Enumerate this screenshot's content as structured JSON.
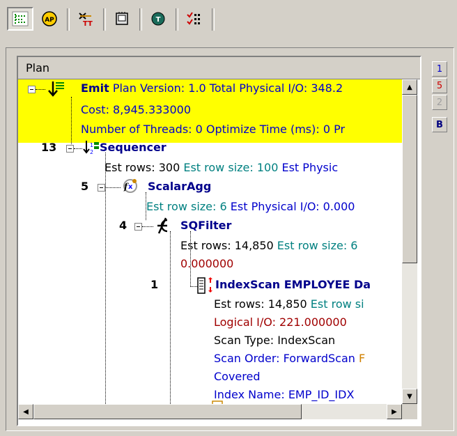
{
  "toolbar": {
    "buttons": [
      {
        "icon": "plan-tree-icon",
        "pressed": true
      },
      {
        "icon": "ap-icon"
      },
      {
        "icon": "text-plan-icon"
      },
      {
        "icon": "memory-icon"
      },
      {
        "icon": "timing-icon"
      },
      {
        "icon": "checklist-icon"
      }
    ]
  },
  "tree": {
    "header": "Plan",
    "emit": {
      "name": "Emit",
      "line1": "Plan Version: 1.0  Total Physical I/O: 348.2",
      "cost": "Cost: 8,945.333000",
      "threads": "Number of Threads: 0  Optimize Time (ms): 0  Pr"
    },
    "sequencer": {
      "id": "13",
      "name": "Sequencer",
      "rows": "Est rows: 300",
      "rowsize": "Est row size: 100",
      "phys": "Est Physic"
    },
    "scalaragg": {
      "id": "5",
      "name": "ScalarAgg",
      "rowsize": "Est row size: 6",
      "phys": "Est Physical I/O: 0.000"
    },
    "sqfilter": {
      "id": "4",
      "name": "SQFilter",
      "rows": "Est rows: 14,850",
      "rowsize": "Est row size: 6",
      "cont": "0.000000"
    },
    "indexscan": {
      "id": "1",
      "name": "IndexScan EMPLOYEE Da",
      "rows": "Est rows: 14,850",
      "rowsize": "Est row si",
      "logical": "Logical I/O: 221.000000",
      "scantype": "Scan Type: IndexScan",
      "scanorder": "Scan Order: ForwardScan",
      "scanorder_extra": "F",
      "covered": "Covered",
      "indexname": "Index Name: EMP_ID_IDX"
    }
  },
  "side_buttons": [
    "1",
    "5",
    "2",
    "B"
  ],
  "colors": {
    "highlight": "#ffff00",
    "node_name": "#00008b",
    "blue_text": "#0000cc",
    "teal_text": "#008080",
    "red_text": "#a00000",
    "orange_text": "#d08000"
  }
}
